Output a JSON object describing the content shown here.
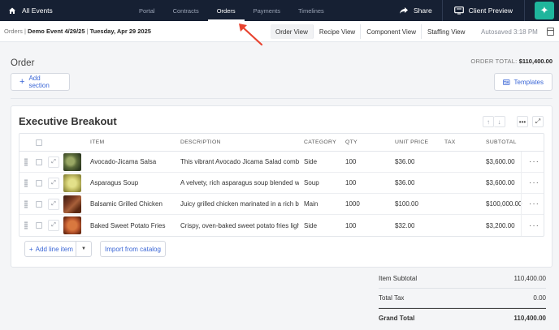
{
  "topnav": {
    "brand_label": "All Events",
    "tabs": [
      {
        "label": "Portal",
        "active": false
      },
      {
        "label": "Contracts",
        "active": false
      },
      {
        "label": "Orders",
        "active": true
      },
      {
        "label": "Payments",
        "active": false
      },
      {
        "label": "Timelines",
        "active": false
      }
    ],
    "share_label": "Share",
    "preview_label": "Client Preview",
    "icons": {
      "home": "home-icon",
      "share": "share-arrow-icon",
      "preview": "monitor-icon",
      "ai": "sparkle-plus-icon"
    },
    "colors": {
      "background": "#162033",
      "ai_button": "#1fb59c"
    }
  },
  "subbar": {
    "breadcrumb_root": "Orders",
    "breadcrumb_event": "Demo Event 4/29/25",
    "breadcrumb_date": "Tuesday, Apr 29 2025",
    "view_tabs": [
      "Order View",
      "Recipe View",
      "Component View",
      "Staffing View"
    ],
    "autosaved": "Autosaved 3:18 PM"
  },
  "order": {
    "title": "Order",
    "total_label": "ORDER TOTAL:",
    "total_value": "$110,400.00",
    "add_section_label": "Add section",
    "templates_label": "Templates"
  },
  "section": {
    "title": "Executive Breakout",
    "columns": {
      "item": "ITEM",
      "description": "DESCRIPTION",
      "category": "CATEGORY",
      "qty": "QTY",
      "unit_price": "UNIT PRICE",
      "tax": "TAX",
      "subtotal": "SUBTOTAL"
    },
    "rows": [
      {
        "item": "Avocado-Jicama Salsa",
        "description": "This vibrant Avocado Jicama Salad combines",
        "category": "Side",
        "qty": "100",
        "unit_price": "$36.00",
        "tax": "",
        "subtotal": "$3,600.00",
        "thumb_color": "#5b6b3a"
      },
      {
        "item": "Asparagus Soup",
        "description": "A velvety, rich asparagus soup blended with",
        "category": "Soup",
        "qty": "100",
        "unit_price": "$36.00",
        "tax": "",
        "subtotal": "$3,600.00",
        "thumb_color": "#c9c46a"
      },
      {
        "item": "Balsamic Grilled Chicken",
        "description": "Juicy grilled chicken marinated in a rich balsamic",
        "category": "Main",
        "qty": "1000",
        "unit_price": "$100.00",
        "tax": "",
        "subtotal": "$100,000.00",
        "thumb_color": "#7a3a22"
      },
      {
        "item": "Baked Sweet Potato Fries",
        "description": "Crispy, oven-baked sweet potato fries lightly",
        "category": "Side",
        "qty": "100",
        "unit_price": "$32.00",
        "tax": "",
        "subtotal": "$3,200.00",
        "thumb_color": "#b8552c"
      }
    ],
    "add_line_label": "Add line item",
    "import_label": "Import from catalog"
  },
  "totals": {
    "item_subtotal_label": "Item Subtotal",
    "item_subtotal_value": "110,400.00",
    "total_tax_label": "Total Tax",
    "total_tax_value": "0.00",
    "grand_total_label": "Grand Total",
    "grand_total_value": "110,400.00"
  },
  "annotation": {
    "arrow_color": "#e8432f"
  }
}
